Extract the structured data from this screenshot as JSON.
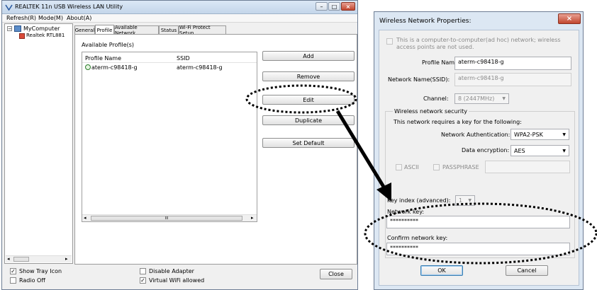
{
  "util": {
    "title": "REALTEK 11n USB Wireless LAN Utility",
    "menu": [
      "Refresh(R)",
      "Mode(M)",
      "About(A)"
    ],
    "tree": {
      "root": "MyComputer",
      "child": "Realtek RTL881"
    },
    "tabs": [
      "General",
      "Profile",
      "Available Network",
      "Status",
      "Wi-Fi Protect Setup"
    ],
    "active_tab": "Profile",
    "profile_section": "Available Profile(s)",
    "columns": [
      "Profile Name",
      "SSID"
    ],
    "rows": [
      {
        "name": "aterm-c98418-g",
        "ssid": "aterm-c98418-g"
      }
    ],
    "buttons": [
      "Add",
      "Remove",
      "Edit",
      "Duplicate",
      "Set Default"
    ],
    "scroll_thumb": "III",
    "show_tray": "Show Tray Icon",
    "radio_off": "Radio Off",
    "disable_adapter": "Disable Adapter",
    "virtual_wifi": "Virtual WiFi allowed",
    "close": "Close"
  },
  "dialog": {
    "title": "Wireless Network Properties:",
    "adhoc": "This is a computer-to-computer(ad hoc) network; wireless access points are not used.",
    "profile_name_label": "Profile Name:",
    "profile_name": "aterm-c98418-g",
    "ssid_label": "Network Name(SSID):",
    "ssid": "aterm-c98418-g",
    "channel_label": "Channel:",
    "channel": "8 (2447MHz)",
    "security_group": "Wireless network security",
    "requires_key": "This network requires a key for the following:",
    "auth_label": "Network Authentication:",
    "auth": "WPA2-PSK",
    "enc_label": "Data encryption:",
    "enc": "AES",
    "ascii": "ASCII",
    "passphrase": "PASSPHRASE",
    "key_index_label": "Key index (advanced):",
    "key_index": "1",
    "network_key_label": "Network key:",
    "network_key": "**********",
    "confirm_label": "Confirm network key:",
    "confirm_key": "**********",
    "ok": "OK",
    "cancel": "Cancel"
  }
}
